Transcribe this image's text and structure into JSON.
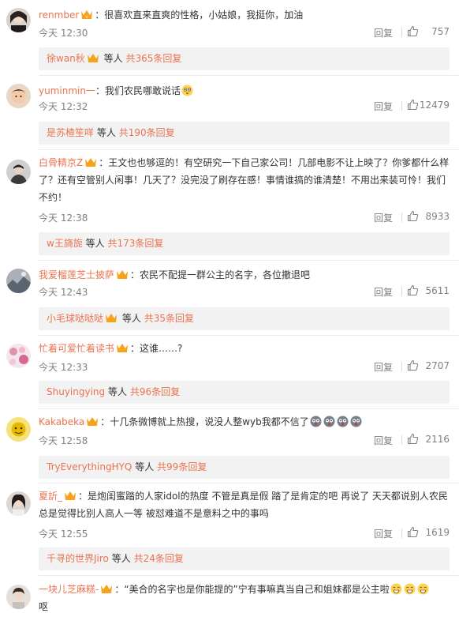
{
  "ui": {
    "reply_label": "回复",
    "others_label": "等人",
    "colors": {
      "username": "#eb7350",
      "meta": "#808080",
      "sub_bg": "#f2f2f2",
      "badge": "#f7a21b"
    }
  },
  "comments": [
    {
      "user": "renmber",
      "text": "：很喜欢直来直爽的性格，小姑娘，我挺你，加油",
      "time": "今天 12:30",
      "likes": "757",
      "sub_user": "徐wan秋",
      "sub_total": "共365条回复"
    },
    {
      "user": "yuminmin一",
      "text": "：我们农民哪敢说话",
      "time": "今天 12:32",
      "likes": "12479",
      "sub_user": "是苏楂笙咩",
      "sub_total": "共190条回复"
    },
    {
      "user": "白骨精京Z",
      "text": "：王文也也够逗的！有空研究一下自己家公司！几部电影不让上映了？你爹都什么样了？还有空管别人闲事！几天了？没完没了刷存在感！事情谁搞的谁清楚！不用出来装可怜！我们不约！",
      "time": "今天 12:38",
      "likes": "8933",
      "sub_user": "w王旖旎",
      "sub_total": "共173条回复"
    },
    {
      "user": "我爱榴莲芝士披萨",
      "text": "：农民不配提一群公主的名字，各位撤退吧",
      "time": "今天 12:43",
      "likes": "5611",
      "sub_user": "小毛球哒哒哒",
      "sub_total": "共35条回复"
    },
    {
      "user": "忙着可爱忙着读书",
      "text": "：这谁……?",
      "time": "今天 12:33",
      "likes": "2707",
      "sub_user": "Shuyingying",
      "sub_total": "共96条回复"
    },
    {
      "user": "Kakabeka",
      "text": "：十几条微博就上热搜，说没人整wyb我都不信了",
      "time": "今天 12:58",
      "likes": "2116",
      "sub_user": "TryEverythingHYQ",
      "sub_total": "共99条回复"
    },
    {
      "user": "夏訢_",
      "text": "：是炮闺蜜踏的人家idol的热度 不管是真是假 踏了是肯定的吧 再说了 天天都说别人农民 总是觉得比别人高人一等 被怼难道不是意料之中的事吗",
      "time": "今天 12:55",
      "likes": "1619",
      "sub_user": "千寻的世界Jiro",
      "sub_total": "共24条回复"
    },
    {
      "user": "一块儿芝麻糕-",
      "text": "：“美合的名字也是你能提的”宁有事嘛真当自己和姐妹都是公主啦",
      "text_tail": "呕"
    }
  ]
}
